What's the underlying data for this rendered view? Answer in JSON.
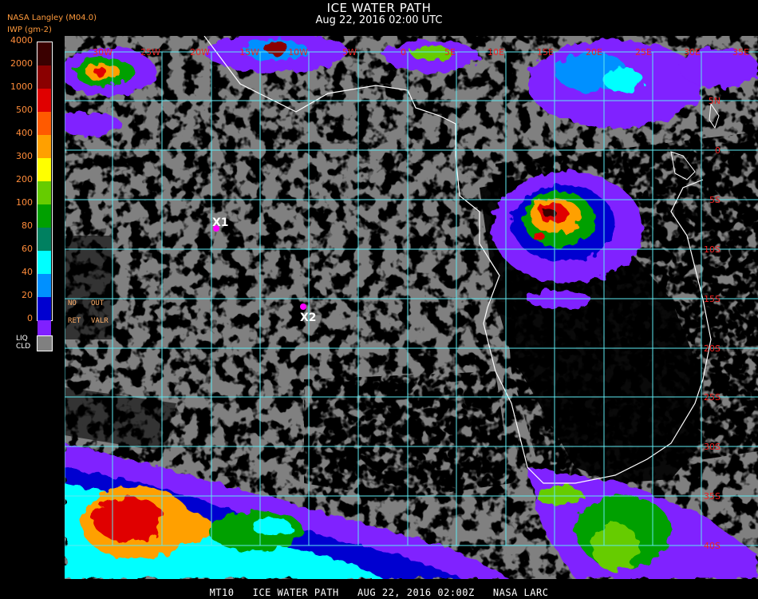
{
  "title": "ICE WATER PATH",
  "subtitle": "Aug 22, 2016 02:00 UTC",
  "source": "NASA Langley (M04.0)",
  "units": "IWP (gm-2)",
  "legend": {
    "labels": [
      "4000",
      "2000",
      "1000",
      "500",
      "400",
      "300",
      "200",
      "100",
      "80",
      "60",
      "40",
      "20",
      "0"
    ],
    "colors": [
      "#3a0000",
      "#8b0000",
      "#e00000",
      "#ff5a00",
      "#ffa000",
      "#ffff00",
      "#66cc00",
      "#00a000",
      "#008060",
      "#00ffff",
      "#0090ff",
      "#0000d0",
      "#8020ff"
    ],
    "no_retrieval": [
      "NO",
      "RET"
    ],
    "out_of_range": [
      "OUT",
      "VALR"
    ],
    "liquid_cloud": [
      "LIQ",
      "CLD"
    ],
    "liquid_cloud_color": "#808080"
  },
  "map": {
    "grid_color": "#5ee8f0",
    "coast_color": "#ffffff",
    "top_labels": [
      "30W",
      "25W",
      "20W",
      "15W",
      "10W",
      "5W",
      "0",
      "5E",
      "10E",
      "15E",
      "20E",
      "25E",
      "30E",
      "35E"
    ],
    "right_labels": [
      "5N",
      "0",
      "5S",
      "10S",
      "15S",
      "20S",
      "25S",
      "30S",
      "35S",
      "40S"
    ],
    "markers": [
      {
        "label": "X1",
        "color": "#ff00ff"
      },
      {
        "label": "X2",
        "color": "#ff00ff"
      }
    ]
  },
  "footer": "MT10   ICE WATER PATH   AUG 22, 2016 02:00Z   NASA LARC"
}
